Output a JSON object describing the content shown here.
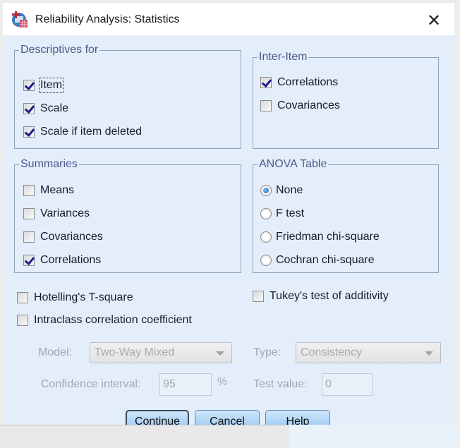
{
  "window": {
    "title": "Reliability Analysis: Statistics",
    "app_icon": "spss-reliability-icon",
    "close_icon": "close-icon",
    "close_glyph": "✕"
  },
  "descriptives": {
    "label": "Descriptives for",
    "items": [
      {
        "label": "Item",
        "checked": true,
        "focused": true
      },
      {
        "label": "Scale",
        "checked": true
      },
      {
        "label": "Scale if item deleted",
        "checked": true
      }
    ]
  },
  "inter_item": {
    "label": "Inter-Item",
    "items": [
      {
        "label": "Correlations",
        "checked": true
      },
      {
        "label": "Covariances",
        "checked": false
      }
    ]
  },
  "summaries": {
    "label": "Summaries",
    "items": [
      {
        "label": "Means",
        "checked": false
      },
      {
        "label": "Variances",
        "checked": false
      },
      {
        "label": "Covariances",
        "checked": false
      },
      {
        "label": "Correlations",
        "checked": true
      }
    ]
  },
  "anova": {
    "label": "ANOVA Table",
    "selected": "None",
    "options": [
      {
        "label": "None",
        "selected": true
      },
      {
        "label": "F test",
        "selected": false
      },
      {
        "label": "Friedman chi-square",
        "selected": false
      },
      {
        "label": "Cochran chi-square",
        "selected": false
      }
    ]
  },
  "extra": {
    "hotelling": {
      "label": "Hotelling's T-square",
      "checked": false
    },
    "tukey": {
      "label": "Tukey's test of additivity",
      "checked": false
    },
    "intraclass": {
      "label": "Intraclass correlation coefficient",
      "checked": false
    }
  },
  "icc": {
    "model_label": "Model:",
    "model_value": "Two-Way Mixed",
    "type_label": "Type:",
    "type_value": "Consistency",
    "ci_label": "Confidence interval:",
    "ci_value": "95",
    "ci_unit": "%",
    "test_value_label": "Test value:",
    "test_value": "0"
  },
  "buttons": {
    "continue": "Continue",
    "cancel": "Cancel",
    "help": "Help"
  }
}
